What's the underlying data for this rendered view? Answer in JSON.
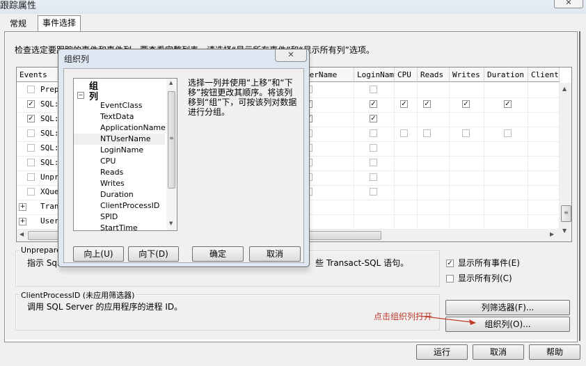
{
  "window": {
    "title": "跟踪属性",
    "close_glyph": "✕"
  },
  "tabs": [
    {
      "label": "常规",
      "active": false
    },
    {
      "label": "事件选择",
      "active": true
    }
  ],
  "instruction": "检查选定要跟踪的事件和事件列。要查看完整列表，请选择“显示所有事件”和“显示所有列”选项。",
  "grid": {
    "headers": [
      "Events",
      "NTUserName",
      "LoginName",
      "CPU",
      "Reads",
      "Writes",
      "Duration",
      "ClientP"
    ],
    "visible_header_prefix": [
      "Events",
      "serName",
      "LoginName",
      "CPU",
      "Reads",
      "Writes",
      "Duration",
      "ClientP"
    ],
    "rows": [
      {
        "type": "event",
        "label": "Prep",
        "checked": false,
        "cols": [
          "off",
          "off",
          "none",
          "none",
          "none",
          "none",
          "none"
        ]
      },
      {
        "type": "event",
        "label": "SQL:",
        "checked": true,
        "cols": [
          "on",
          "on",
          "on",
          "on",
          "on",
          "on",
          "none"
        ]
      },
      {
        "type": "event",
        "label": "SQL:",
        "checked": true,
        "cols": [
          "on",
          "on",
          "none",
          "none",
          "none",
          "none",
          "none"
        ]
      },
      {
        "type": "event",
        "label": "SQL:",
        "checked": false,
        "cols": [
          "off",
          "off",
          "off",
          "off",
          "off",
          "off",
          "none"
        ]
      },
      {
        "type": "event",
        "label": "SQL:",
        "checked": false,
        "cols": [
          "off",
          "off",
          "none",
          "none",
          "none",
          "none",
          "none"
        ]
      },
      {
        "type": "event",
        "label": "SQL:",
        "checked": false,
        "cols": [
          "off",
          "off",
          "none",
          "none",
          "none",
          "none",
          "none"
        ]
      },
      {
        "type": "event",
        "label": "Unpr",
        "checked": false,
        "cols": [
          "off",
          "off",
          "none",
          "none",
          "none",
          "none",
          "none"
        ]
      },
      {
        "type": "event",
        "label": "XQue",
        "checked": false,
        "cols": [
          "off",
          "off",
          "none",
          "none",
          "none",
          "none",
          "none"
        ]
      },
      {
        "type": "category",
        "label": "Tran"
      },
      {
        "type": "category",
        "label": "User"
      }
    ]
  },
  "event_description": {
    "legend": "Unprepare",
    "text": "指示 SqlClient、ODBC、OLE DB 或 DB-Library 已经准备好了要删除的一个或多个准备好的 Transact-SQL 语句。",
    "visible_left": "指示 Sql",
    "visible_right": "些 Transact-SQL 语句。"
  },
  "column_description": {
    "legend": "ClientProcessID (未应用筛选器)",
    "text": "调用 SQL Server 的应用程序的进程 ID。"
  },
  "options": {
    "show_all_events": {
      "label": "显示所有事件(E)",
      "checked": true
    },
    "show_all_columns": {
      "label": "显示所有列(C)",
      "checked": false
    }
  },
  "buttons": {
    "column_filters": "列筛选器(F)...",
    "organize_columns": "组织列(O)...",
    "run": "运行",
    "cancel": "取消",
    "help": "帮助"
  },
  "annotation": {
    "text": "点击组织列打开",
    "color": "#c0392b"
  },
  "dialog": {
    "title": "组织列",
    "close_glyph": "✕",
    "tree": {
      "groups_label": "组",
      "columns_label": "列",
      "columns": [
        "EventClass",
        "TextData",
        "ApplicationName",
        "NTUserName",
        "LoginName",
        "CPU",
        "Reads",
        "Writes",
        "Duration",
        "ClientProcessID",
        "SPID",
        "StartTime"
      ],
      "selected": "NTUserName"
    },
    "help_text": "选择一列并使用“上移”和“下移”按钮更改其顺序。将该列移到“组”下，可按该列对数据进行分组。",
    "buttons": {
      "up": "向上(U)",
      "down": "向下(D)",
      "ok": "确定",
      "cancel": "取消"
    }
  }
}
